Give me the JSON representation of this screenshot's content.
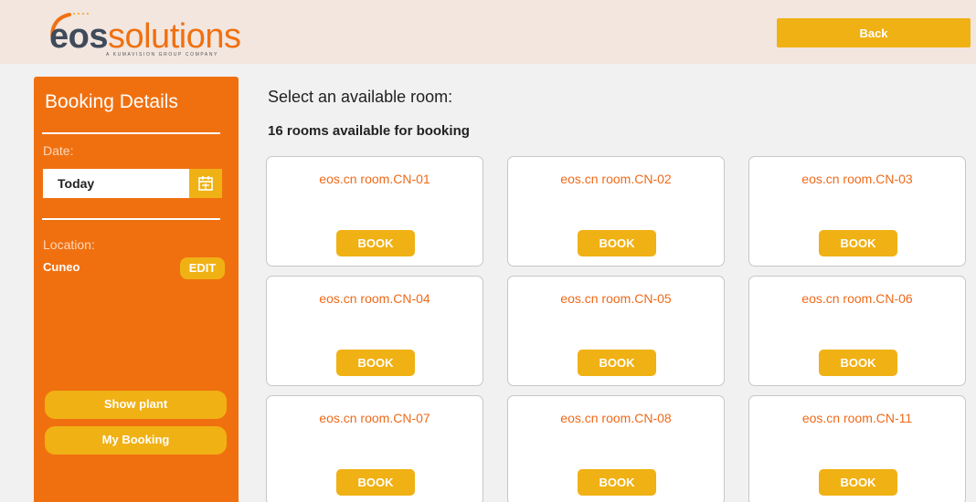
{
  "header": {
    "logo_text_bold": "eos",
    "logo_text_light": "solutions",
    "logo_tagline": "A KUMAVISION GROUP COMPANY",
    "back_label": "Back"
  },
  "colors": {
    "brand_orange": "#f07010",
    "accent_yellow": "#f0b114",
    "room_title": "#ee6a1a",
    "header_bg": "#f2e6df",
    "page_bg": "#f1f1f1"
  },
  "sidebar": {
    "title": "Booking Details",
    "date_label": "Date:",
    "date_value": "Today",
    "calendar_icon": "calendar-icon",
    "location_label": "Location:",
    "location_value": "Cuneo",
    "edit_label": "EDIT",
    "show_plant_label": "Show plant",
    "my_booking_label": "My Booking"
  },
  "main": {
    "title": "Select an available room:",
    "subtitle": "16 rooms available for booking",
    "book_label": "BOOK",
    "rooms": [
      {
        "name": "eos.cn room.CN-01"
      },
      {
        "name": "eos.cn room.CN-02"
      },
      {
        "name": "eos.cn room.CN-03"
      },
      {
        "name": "eos.cn room.CN-04"
      },
      {
        "name": "eos.cn room.CN-05"
      },
      {
        "name": "eos.cn room.CN-06"
      },
      {
        "name": "eos.cn room.CN-07"
      },
      {
        "name": "eos.cn room.CN-08"
      },
      {
        "name": "eos.cn room.CN-11"
      }
    ]
  }
}
